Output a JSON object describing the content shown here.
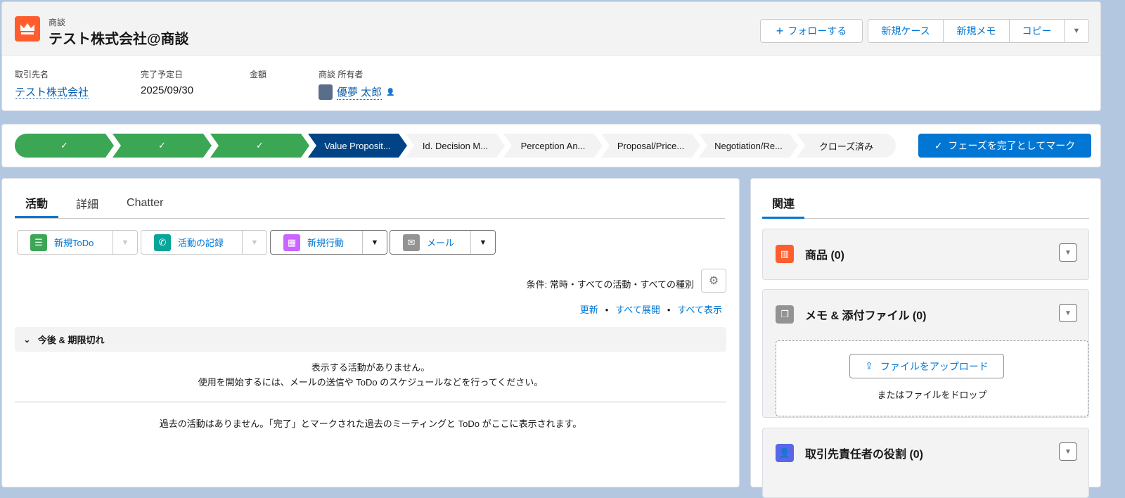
{
  "header": {
    "object_type": "商談",
    "title": "テスト株式会社@商談",
    "buttons": {
      "follow": "フォローする",
      "new_case": "新規ケース",
      "new_note": "新規メモ",
      "copy": "コピー"
    },
    "fields": [
      {
        "label": "取引先名",
        "value": "テスト株式会社"
      },
      {
        "label": "完了予定日",
        "value": "2025/09/30"
      },
      {
        "label": "金額",
        "value": ""
      },
      {
        "label": "商談 所有者",
        "value": "優夢 太郎"
      }
    ]
  },
  "path": {
    "stages": [
      {
        "label": "",
        "status": "done"
      },
      {
        "label": "",
        "status": "done"
      },
      {
        "label": "",
        "status": "done"
      },
      {
        "label": "Value Proposit...",
        "status": "current"
      },
      {
        "label": "Id. Decision M...",
        "status": "todo"
      },
      {
        "label": "Perception An...",
        "status": "todo"
      },
      {
        "label": "Proposal/Price...",
        "status": "todo"
      },
      {
        "label": "Negotiation/Re...",
        "status": "todo"
      },
      {
        "label": "クローズ済み",
        "status": "todo"
      }
    ],
    "mark_complete": "フェーズを完了としてマーク"
  },
  "activity": {
    "tabs": [
      "活動",
      "詳細",
      "Chatter"
    ],
    "actions": [
      {
        "label": "新規ToDo",
        "color": "#3ba755"
      },
      {
        "label": "活動の記録",
        "color": "#06a59a"
      },
      {
        "label": "新規行動",
        "color": "#cb65ff"
      },
      {
        "label": "メール",
        "color": "#939393"
      }
    ],
    "filter": "条件: 常時・すべての活動・すべての種別",
    "links": [
      "更新",
      "すべて展開",
      "すべて表示"
    ],
    "section": "今後 & 期限切れ",
    "empty_line1": "表示する活動がありません。",
    "empty_line2": "使用を開始するには、メールの送信や ToDo のスケジュールなどを行ってください。",
    "past": "過去の活動はありません。「完了」とマークされた過去のミーティングと ToDo がここに表示されます。"
  },
  "related": {
    "tab": "関連",
    "cards": [
      {
        "title": "商品 (0)",
        "color": "#ff5d2d"
      },
      {
        "title": "メモ & 添付ファイル (0)",
        "color": "#939393"
      },
      {
        "title": "取引先責任者の役割 (0)",
        "color": "#5867e8"
      }
    ],
    "upload": "ファイルをアップロード",
    "drop": "またはファイルをドロップ"
  }
}
